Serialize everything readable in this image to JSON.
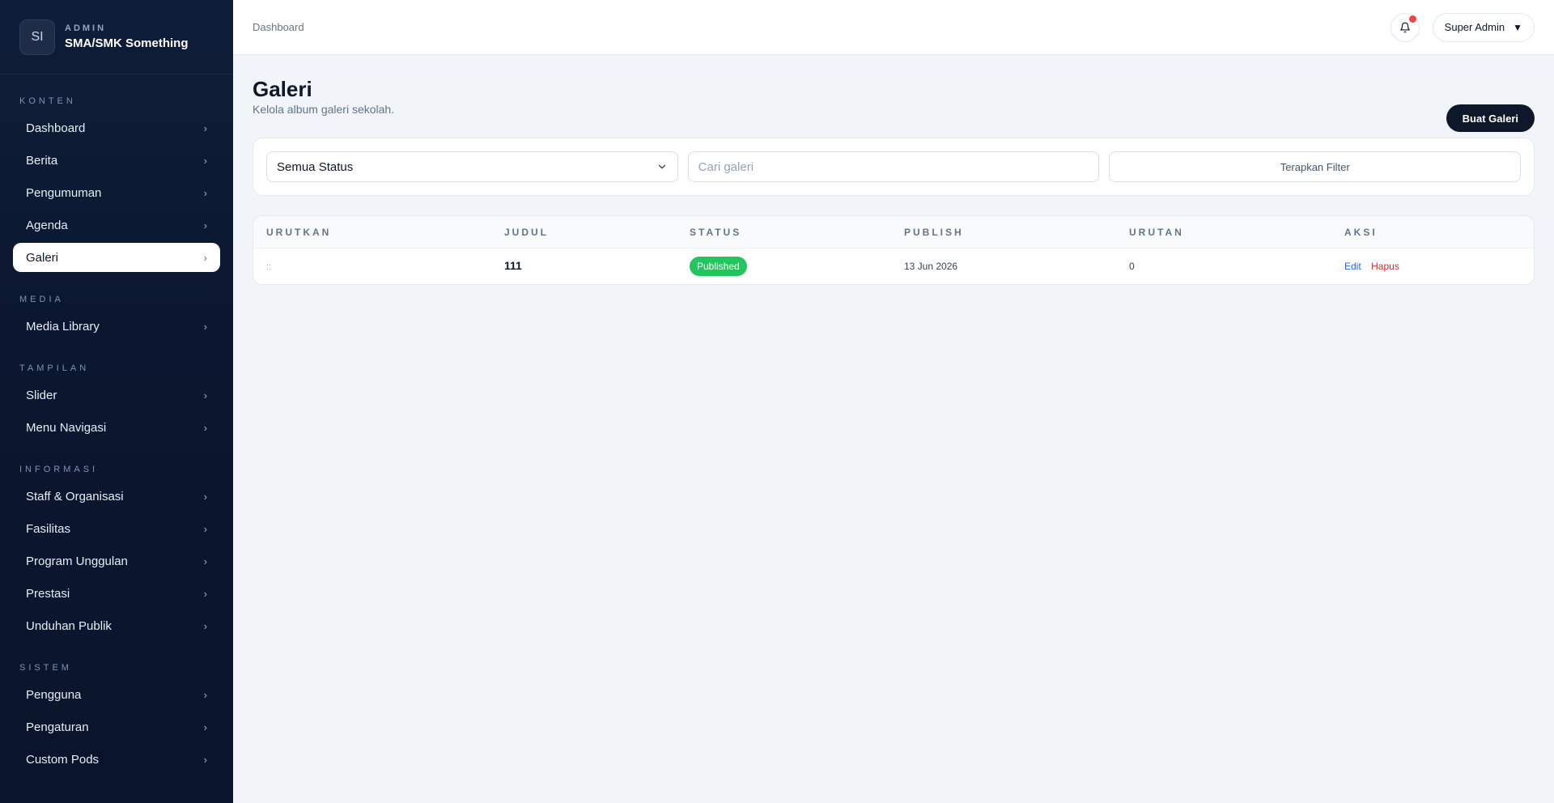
{
  "brand": {
    "logo": "SI",
    "kicker": "ADMIN",
    "name": "SMA/SMK Something"
  },
  "sidebar": {
    "sections": [
      {
        "title": "KONTEN",
        "items": [
          "Dashboard",
          "Berita",
          "Pengumuman",
          "Agenda",
          "Galeri"
        ]
      },
      {
        "title": "MEDIA",
        "items": [
          "Media Library"
        ]
      },
      {
        "title": "TAMPILAN",
        "items": [
          "Slider",
          "Menu Navigasi"
        ]
      },
      {
        "title": "INFORMASI",
        "items": [
          "Staff & Organisasi",
          "Fasilitas",
          "Program Unggulan",
          "Prestasi",
          "Unduhan Publik"
        ]
      },
      {
        "title": "SISTEM",
        "items": [
          "Pengguna",
          "Pengaturan",
          "Custom Pods"
        ]
      }
    ],
    "active": "Galeri",
    "chevron": "›"
  },
  "header": {
    "breadcrumb": "Dashboard",
    "user": "Super Admin",
    "caret": "▼",
    "bell_icon": "bell-icon"
  },
  "page": {
    "title": "Galeri",
    "subtitle": "Kelola album galeri sekolah.",
    "create_label": "Buat Galeri"
  },
  "filters": {
    "status_value": "Semua Status",
    "search_placeholder": "Cari galeri",
    "apply_label": "Terapkan Filter"
  },
  "table": {
    "columns": [
      "URUTKAN",
      "JUDUL",
      "STATUS",
      "PUBLISH",
      "URUTAN",
      "AKSI"
    ],
    "rows": [
      {
        "handle": "::",
        "title": "111",
        "status": "Published",
        "publish": "13 Jun 2026",
        "order": "0",
        "edit": "Edit",
        "delete": "Hapus"
      }
    ]
  },
  "colors": {
    "sidebar_bg": "#0b1730",
    "accent_dark": "#0f172a",
    "published": "#22c55e",
    "edit_link": "#2563eb",
    "delete_link": "#dc2626",
    "notification_dot": "#ef4444"
  }
}
